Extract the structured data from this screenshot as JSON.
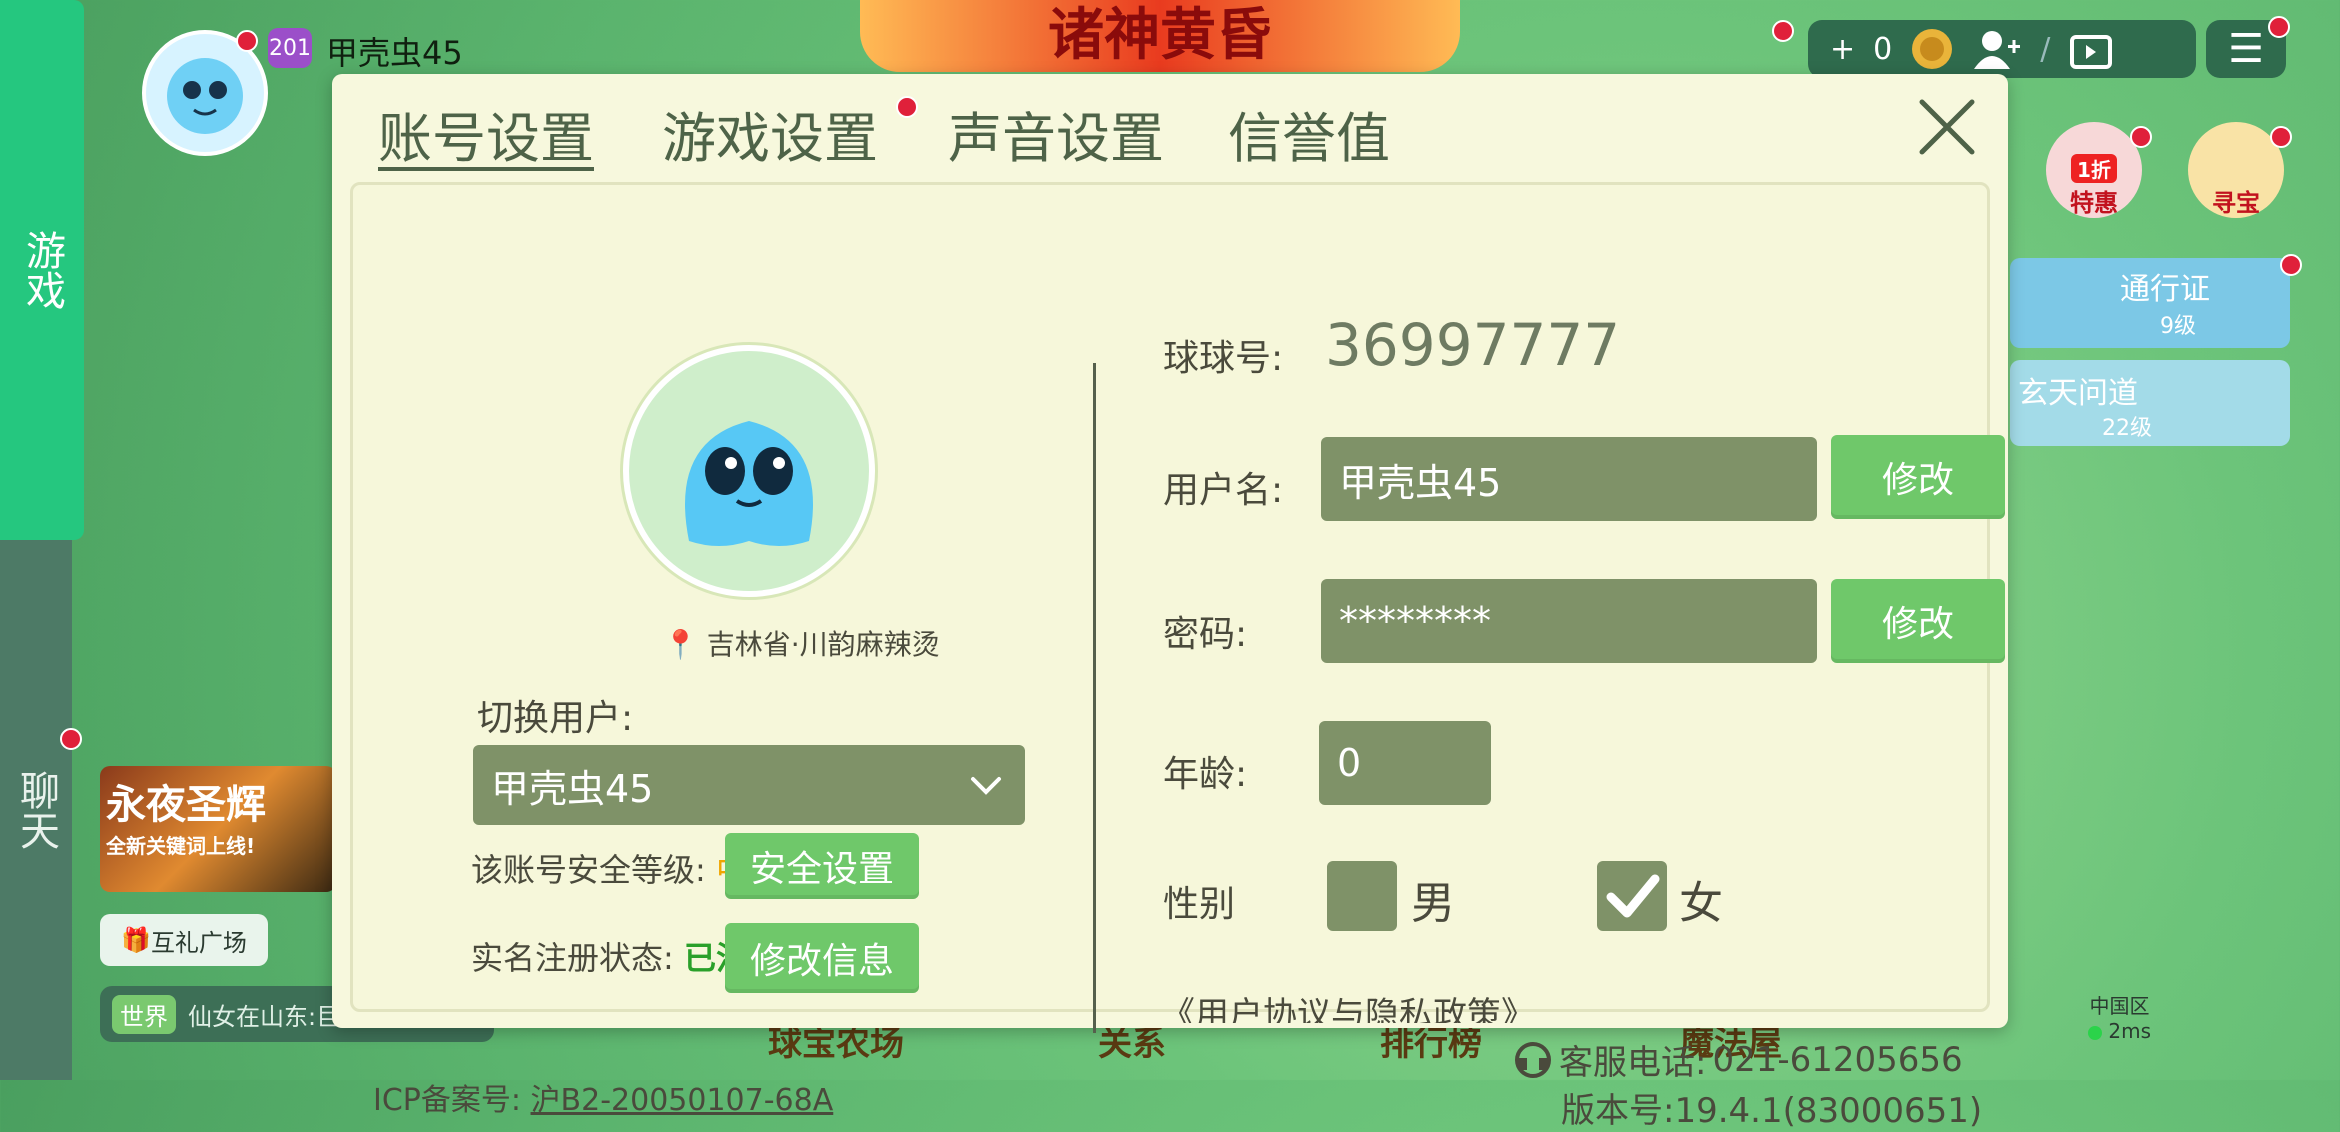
{
  "rail": {
    "game_label": "游戏",
    "chat_label": "聊天"
  },
  "top": {
    "level": "201",
    "player_name": "甲壳虫45",
    "banner_title": "诸神黄昏",
    "coins": "0",
    "coin_prefix": "+"
  },
  "side": {
    "sale_label": "特惠",
    "sale_badge": "1折",
    "treasure_label": "寻宝",
    "pass_label": "通行证",
    "pass_level": "9级",
    "xuantian_label": "玄天问道",
    "xuantian_level": "22级"
  },
  "left": {
    "banner_title": "永夜圣辉",
    "banner_sub": "全新关键词上线!",
    "gift_plaza": "互礼广场",
    "world_tag": "世界",
    "world_msg": "仙女在山东:巨"
  },
  "bottom_nav": [
    "球宝农场",
    "关系",
    "排行榜",
    "魔法屋"
  ],
  "region": {
    "name": "中国区",
    "ping": "2ms"
  },
  "modal": {
    "tabs": [
      "账号设置",
      "游戏设置",
      "声音设置",
      "信誉值"
    ],
    "location": "吉林省·川韵麻辣烫",
    "switch_user_label": "切换用户:",
    "current_user": "甲壳虫45",
    "security_label": "该账号安全等级:",
    "security_level": "中",
    "security_btn": "安全设置",
    "realname_label": "实名注册状态:",
    "realname_status": "已注册",
    "edit_info_btn": "修改信息",
    "icp_label": "ICP备案号:",
    "icp_value": "沪B2-20050107-68A",
    "qq_label": "球球号:",
    "qq_number": "36997777",
    "username_label": "用户名:",
    "username_value": "甲壳虫45",
    "edit_btn": "修改",
    "password_label": "密码:",
    "password_value": "********",
    "age_label": "年龄:",
    "age_value": "0",
    "gender_label": "性别",
    "male_label": "男",
    "female_label": "女",
    "gender_selected": "女",
    "policy_link": "《用户协议与隐私政策》",
    "service_label": "客服电话:",
    "service_phone": "021-61205656",
    "version_label": "版本号:",
    "version_value": "19.4.1(83000651)"
  },
  "colors": {
    "accent_green": "#6fc86a",
    "field": "#7f9268",
    "panel": "#f7f8dd",
    "notify_red": "#e0203a"
  }
}
